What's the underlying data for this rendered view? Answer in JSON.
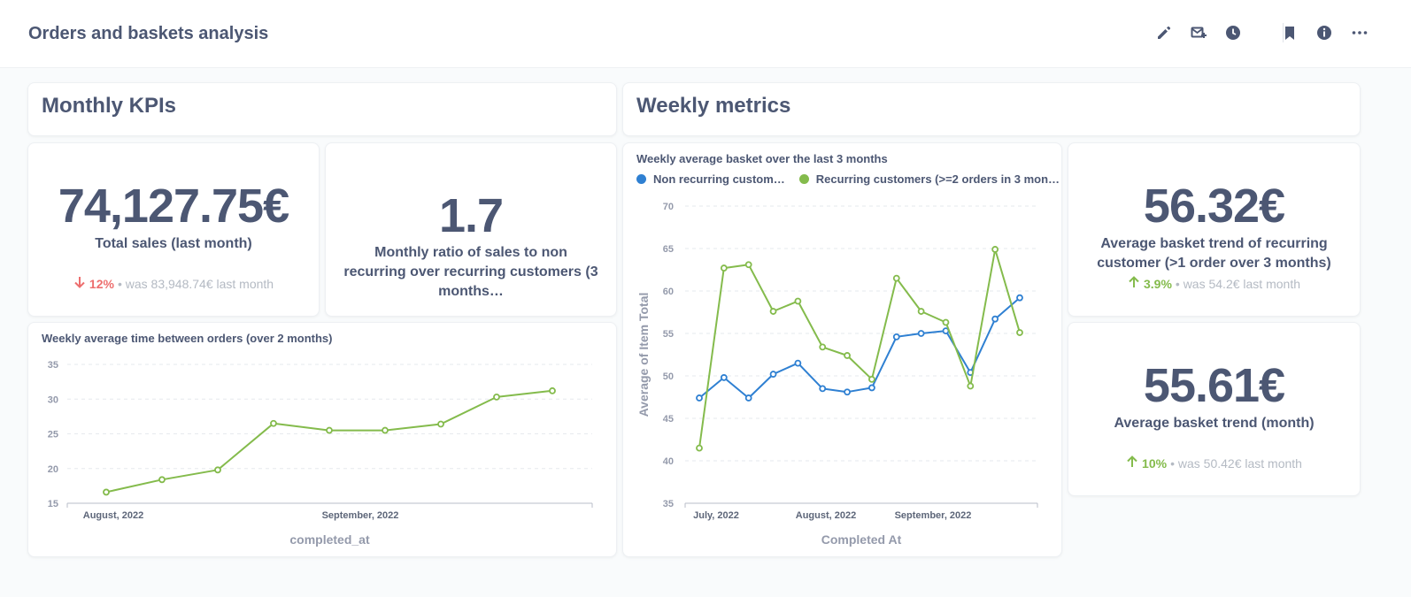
{
  "header": {
    "title": "Orders and baskets analysis",
    "icons": [
      "pencil-icon",
      "subscription-icon",
      "history-icon",
      "bookmark-icon",
      "info-icon",
      "more-icon"
    ]
  },
  "sections": {
    "monthly": "Monthly KPIs",
    "weekly": "Weekly metrics"
  },
  "kpis": {
    "total_sales": {
      "value": "74,127.75€",
      "label": "Total sales (last month)",
      "trend_pct": "12%",
      "trend_dir": "down",
      "trend_was": "• was 83,948.74€  last month"
    },
    "ratio": {
      "value": "1.7",
      "label": "Monthly ratio of sales to non recurring over recurring customers (3 months…"
    },
    "recurring_trend": {
      "value": "56.32€",
      "label": "Average basket trend of recurring customer (>1 order over 3 months)",
      "trend_pct": "3.9%",
      "trend_dir": "up",
      "trend_was": "• was 54.2€  last month"
    },
    "basket_trend": {
      "value": "55.61€",
      "label": "Average basket trend (month)",
      "trend_pct": "10%",
      "trend_dir": "up",
      "trend_was": "• was 50.42€  last month"
    }
  },
  "colors": {
    "blue": "#2f80d2",
    "green": "#84bb4c",
    "text": "#4c5773",
    "down": "#ed6e6e"
  },
  "chart_data": [
    {
      "type": "line",
      "title": "Weekly average time between orders (over 2 months)",
      "xlabel": "completed_at",
      "ylabel": "",
      "x_ticks": [
        "August, 2022",
        "September, 2022"
      ],
      "ylim": [
        15,
        35
      ],
      "y_ticks": [
        15,
        20,
        25,
        30,
        35
      ],
      "grid": true,
      "series": [
        {
          "color": "#84bb4c",
          "values": [
            16.6,
            18.4,
            19.8,
            26.5,
            25.5,
            25.5,
            26.4,
            30.3,
            31.2
          ]
        }
      ]
    },
    {
      "type": "line",
      "title": "Weekly average basket over the last 3 months",
      "xlabel": "Completed At",
      "ylabel": "Average of Item Total",
      "x_ticks": [
        "July, 2022",
        "August, 2022",
        "September, 2022"
      ],
      "ylim": [
        35,
        70
      ],
      "y_ticks": [
        35,
        40,
        45,
        50,
        55,
        60,
        65,
        70
      ],
      "grid": true,
      "legend": "top",
      "series": [
        {
          "name": "Non recurring custom…",
          "color": "#2f80d2",
          "values": [
            47.4,
            49.8,
            47.4,
            50.2,
            51.5,
            48.5,
            48.1,
            48.6,
            54.6,
            55.0,
            55.3,
            50.4,
            56.7,
            59.2
          ]
        },
        {
          "name": "Recurring customers (>=2 orders in 3 mon…",
          "color": "#84bb4c",
          "values": [
            41.5,
            62.7,
            63.1,
            57.6,
            58.8,
            53.4,
            52.4,
            49.6,
            61.5,
            57.6,
            56.3,
            48.8,
            64.9,
            55.1
          ]
        }
      ]
    }
  ]
}
